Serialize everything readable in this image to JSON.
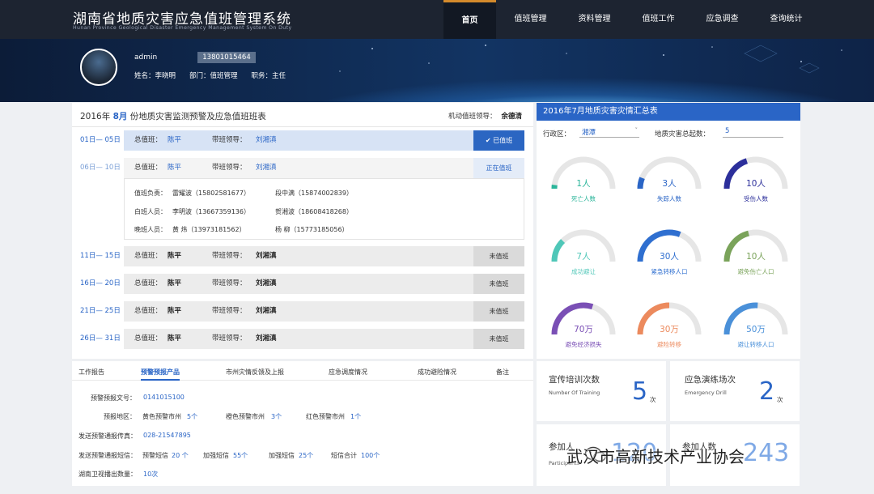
{
  "app": {
    "title": "湖南省地质灾害应急值班管理系统",
    "subtitle": "Hunan Province Geological Disaster Emergency Management System On Duty"
  },
  "nav": [
    "首页",
    "值班管理",
    "资料管理",
    "值班工作",
    "应急调查",
    "查询统计"
  ],
  "user": {
    "username": "admin",
    "phone": "13801015464",
    "name": "姓名：李晓明",
    "dept": "部门：值班管理",
    "title": "职务：主任"
  },
  "schedule": {
    "title_prefix": "2016年",
    "month": "8月",
    "title_suffix": "份地质灾害监测预警及应急值班班表",
    "mobile_leader_label": "机动值班领导：",
    "mobile_leader": "余德清",
    "chief_label": "总值班：",
    "leader_label": "带班领导：",
    "rows": [
      {
        "dates": "01日— 05日",
        "chief": "陈平",
        "leader": "刘湘滇",
        "status": "已值班"
      },
      {
        "dates": "06日— 10日",
        "chief": "陈平",
        "leader": "刘湘滇",
        "status": "正在值班"
      },
      {
        "dates": "11日— 15日",
        "chief": "陈平",
        "leader": "刘湘滇",
        "status": "未值班"
      },
      {
        "dates": "16日— 20日",
        "chief": "陈平",
        "leader": "刘湘滇",
        "status": "未值班"
      },
      {
        "dates": "21日— 25日",
        "chief": "陈平",
        "leader": "刘湘滇",
        "status": "未值班"
      },
      {
        "dates": "26日— 31日",
        "chief": "陈平",
        "leader": "刘湘滇",
        "status": "未值班"
      }
    ],
    "detail": {
      "l1": "值班负责：",
      "v1": "雷耀波（15802581677）",
      "v1b": "段中满（15874002839）",
      "l2": "白班人员：",
      "v2": "李明波（13667359136）",
      "v2b": "贺湘波（18608418268）",
      "l3": "晚班人员：",
      "v3": "黄 炜（13973181562）",
      "v3b": "杨 柳（15773185056）"
    }
  },
  "report": {
    "tabs": [
      "工作报告",
      "预警预报产品",
      "市州灾情反馈及上报",
      "应急调度情况",
      "成功避险情况",
      "备注"
    ],
    "doc_label": "预警预报文号：",
    "doc_value": "0141015100",
    "area_label": "预报地区：",
    "yellow_label": "黄色预警市州",
    "yellow_value": "5个",
    "orange_label": "橙色预警市州",
    "orange_value": "3个",
    "red_label": "红色预警市州",
    "red_value": "1个",
    "fax_label": "发送预警通报传真：",
    "fax_value": "028-21547895",
    "sms_label": "发送预警通报短信：",
    "sms1_label": "预警短信",
    "sms1_value": "20 个",
    "sms2_label": "加强短信",
    "sms2_value": "55个",
    "sms3_label": "加强短信",
    "sms3_value": "25个",
    "sms4_label": "短信合计",
    "sms4_value": "100个",
    "tv_label": "湖南卫视播出数量：",
    "tv_value": "10次"
  },
  "summary": {
    "title": "2016年7月地质灾害灾情汇总表",
    "region_label": "行政区：",
    "region_value": "湘潭",
    "total_label": "地质灾害总起数：",
    "total_value": "5",
    "gauges": [
      {
        "value": "1人",
        "label": "死亡人数",
        "color": "#2bb59a",
        "fraction": 0.04
      },
      {
        "value": "3人",
        "label": "失踪人数",
        "color": "#2a65c6",
        "fraction": 0.12
      },
      {
        "value": "10人",
        "label": "受伤人数",
        "color": "#2c2f9b",
        "fraction": 0.4
      },
      {
        "value": "7人",
        "label": "成功避让",
        "color": "#4fc7b8",
        "fraction": 0.25
      },
      {
        "value": "30人",
        "label": "紧急转移人口",
        "color": "#2f6fd0",
        "fraction": 0.62
      },
      {
        "value": "10人",
        "label": "避免伤亡人口",
        "color": "#7aa35a",
        "fraction": 0.42
      },
      {
        "value": "70万",
        "label": "避免经济损失",
        "color": "#7a4fb5",
        "fraction": 0.6
      },
      {
        "value": "30万",
        "label": "避险转移",
        "color": "#ec8a5d",
        "fraction": 0.5
      },
      {
        "value": "50万",
        "label": "避让转移人口",
        "color": "#4a90d9",
        "fraction": 0.52
      }
    ]
  },
  "stats": {
    "training_label": "宣传培训次数",
    "training_en": "Number Of Training",
    "training_value": "5",
    "drill_label": "应急演练场次",
    "drill_en": "Emergency Drill",
    "drill_value": "2",
    "unit": "次",
    "participants_label": "参加人",
    "participants_en": "Participants",
    "participants_value": "120",
    "p2_label": "参加人数",
    "p2_value": "243"
  },
  "watermark": "武汉市高新技术产业协会"
}
